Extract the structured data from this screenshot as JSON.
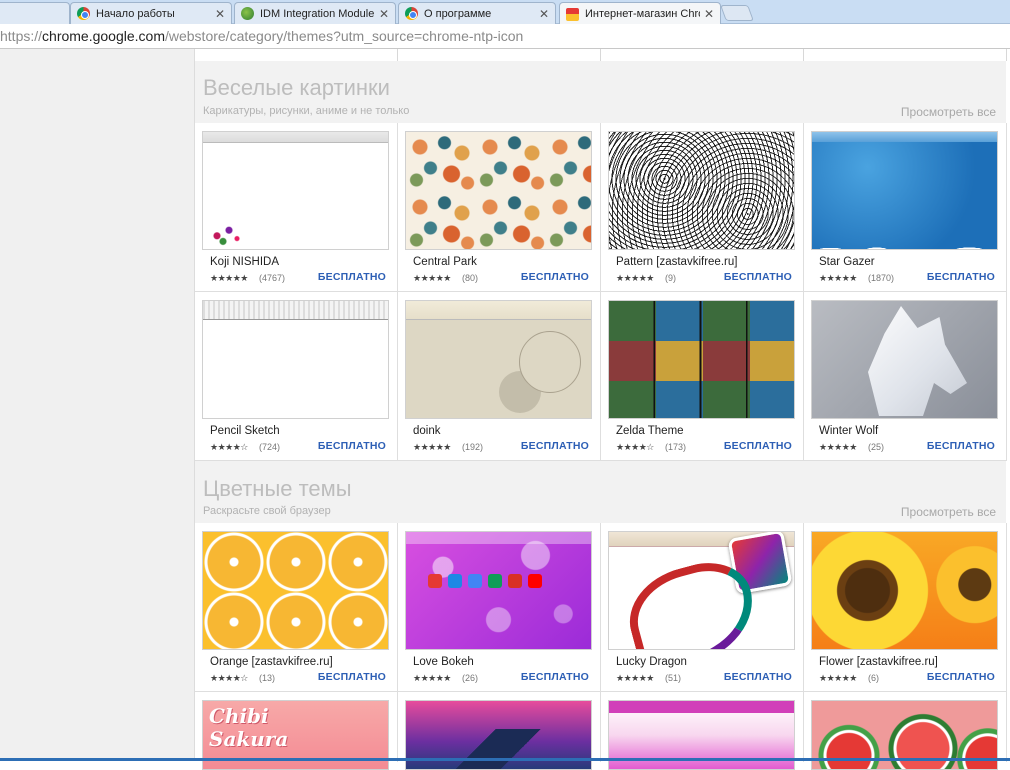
{
  "tabs": [
    {
      "label": "Начало работы",
      "icon": "chrome-icon"
    },
    {
      "label": "IDM Integration Module",
      "icon": "idm-icon"
    },
    {
      "label": "О программе",
      "icon": "chrome-icon"
    },
    {
      "label": "Интернет-магазин Chrom",
      "icon": "webstore-icon",
      "active": true
    }
  ],
  "address_bar": {
    "scheme": "https://",
    "host": "chrome.google.com",
    "path": "/webstore/category/themes?utm_source=chrome-ntp-icon"
  },
  "sections": [
    {
      "title": "Веселые картинки",
      "subtitle": "Карикатуры, рисунки, аниме и не только",
      "see_all": "Просмотреть все",
      "items": [
        {
          "name": "Koji NISHIDA",
          "stars": "★★★★★",
          "count": "(4767)",
          "price": "БЕСПЛАТНО"
        },
        {
          "name": "Central Park",
          "stars": "★★★★★",
          "count": "(80)",
          "price": "БЕСПЛАТНО"
        },
        {
          "name": "Pattern [zastavkifree.ru]",
          "stars": "★★★★★",
          "count": "(9)",
          "price": "БЕСПЛАТНО"
        },
        {
          "name": "Star Gazer",
          "stars": "★★★★★",
          "count": "(1870)",
          "price": "БЕСПЛАТНО"
        },
        {
          "name": "Pencil Sketch",
          "stars": "★★★★☆",
          "count": "(724)",
          "price": "БЕСПЛАТНО"
        },
        {
          "name": "doink",
          "stars": "★★★★★",
          "count": "(192)",
          "price": "БЕСПЛАТНО"
        },
        {
          "name": "Zelda Theme",
          "stars": "★★★★☆",
          "count": "(173)",
          "price": "БЕСПЛАТНО"
        },
        {
          "name": "Winter Wolf",
          "stars": "★★★★★",
          "count": "(25)",
          "price": "БЕСПЛАТНО"
        }
      ]
    },
    {
      "title": "Цветные темы",
      "subtitle": "Раскрасьте свой браузер",
      "see_all": "Просмотреть все",
      "items": [
        {
          "name": "Orange [zastavkifree.ru]",
          "stars": "★★★★☆",
          "count": "(13)",
          "price": "БЕСПЛАТНО"
        },
        {
          "name": "Love Bokeh",
          "stars": "★★★★★",
          "count": "(26)",
          "price": "БЕСПЛАТНО"
        },
        {
          "name": "Lucky Dragon",
          "stars": "★★★★★",
          "count": "(51)",
          "price": "БЕСПЛАТНО"
        },
        {
          "name": "Flower [zastavkifree.ru]",
          "stars": "★★★★★",
          "count": "(6)",
          "price": "БЕСПЛАТНО"
        }
      ],
      "next_row_partial": [
        {
          "chibi_text": "Chibi\nSakura"
        }
      ]
    }
  ],
  "colors": {
    "price_link": "#2d5fb5",
    "tabstrip": "#c9ddf3",
    "section_title": "#bdbdbd"
  }
}
